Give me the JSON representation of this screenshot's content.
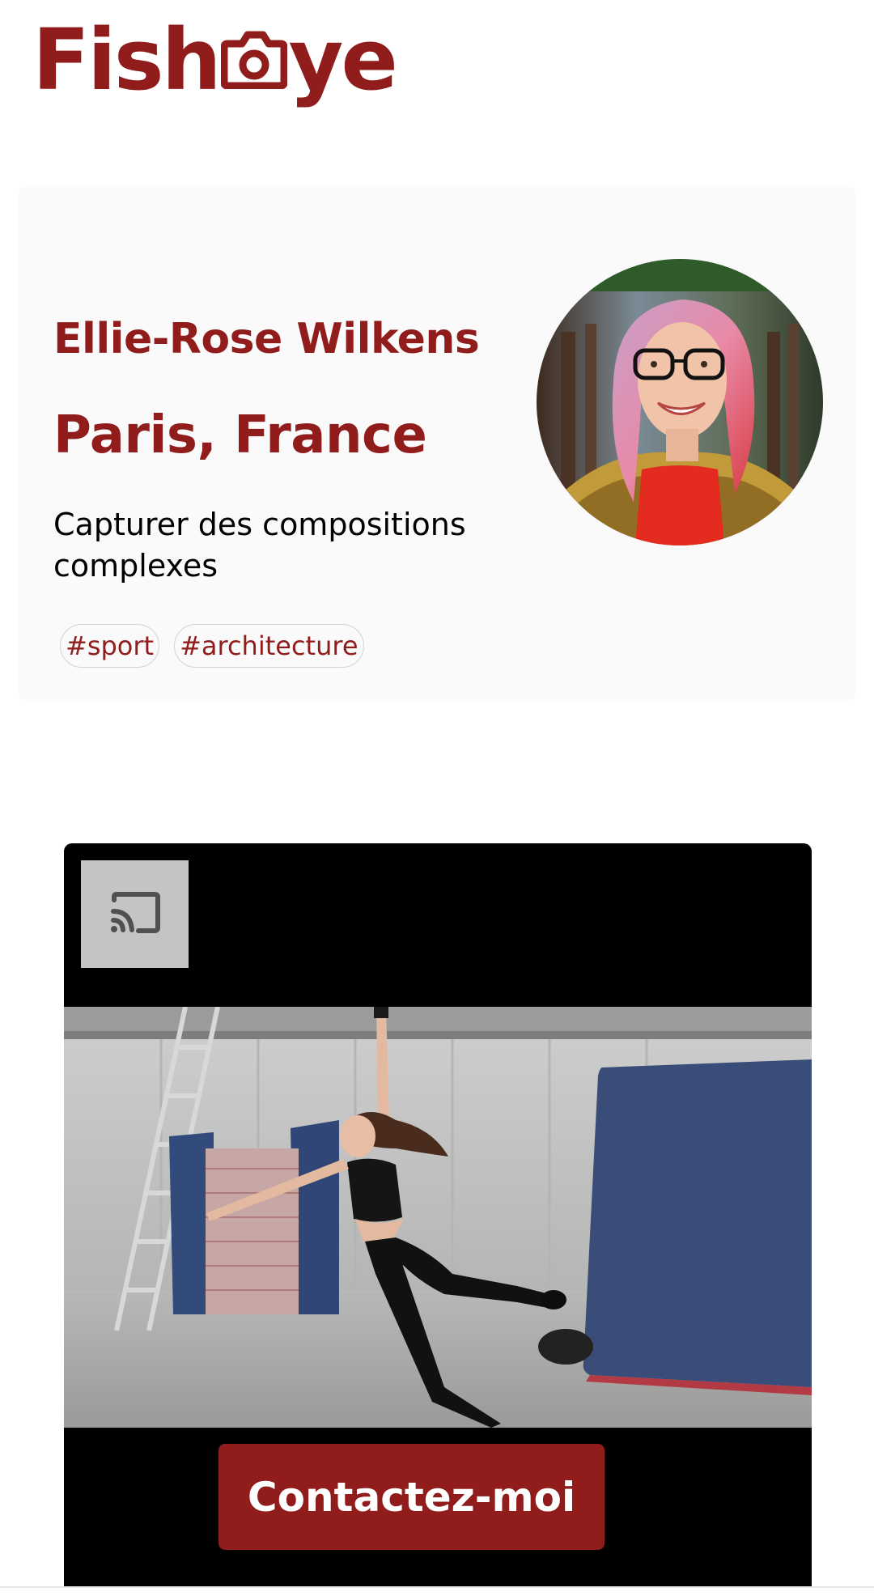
{
  "header": {
    "logo": {
      "text_before": "Fish",
      "icon": "camera-icon",
      "text_after": "ye",
      "color": "#901c1c"
    }
  },
  "profile": {
    "name": "Ellie-Rose Wilkens",
    "location": "Paris, France",
    "tagline": "Capturer des compositions complexes",
    "tags": [
      "#sport",
      "#architecture"
    ],
    "avatar": {
      "icon": "portrait-photo"
    },
    "card_background": "#fafafa"
  },
  "media": {
    "cast_icon": "cast-icon",
    "video": {
      "icon": "gymnast-photo"
    }
  },
  "contact": {
    "label": "Contactez-moi",
    "color": "#901c1c"
  }
}
